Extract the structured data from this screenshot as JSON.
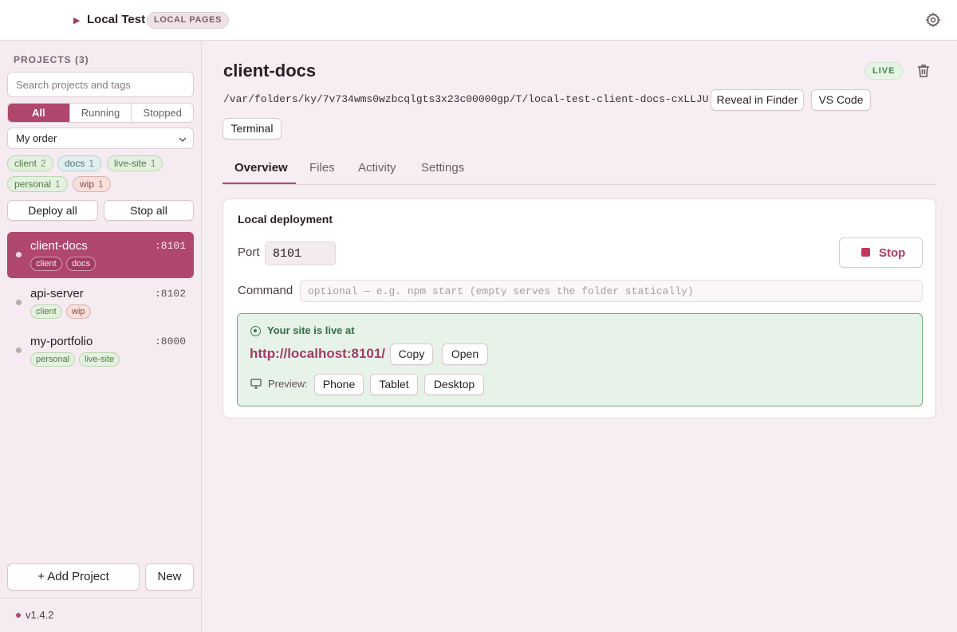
{
  "titlebar": {
    "app_title": "Local Test",
    "badge": "LOCAL PAGES"
  },
  "sidebar": {
    "heading": "PROJECTS (3)",
    "search_placeholder": "Search projects and tags",
    "filters": [
      "All",
      "Running",
      "Stopped"
    ],
    "sort": "My order",
    "tags": [
      {
        "name": "client",
        "count": "2",
        "color": "green"
      },
      {
        "name": "docs",
        "count": "1",
        "color": "teal"
      },
      {
        "name": "live-site",
        "count": "1",
        "color": "green"
      },
      {
        "name": "personal",
        "count": "1",
        "color": "green"
      },
      {
        "name": "wip",
        "count": "1",
        "color": "red"
      }
    ],
    "deploy_all": "Deploy all",
    "stop_all": "Stop all",
    "projects": [
      {
        "name": "client-docs",
        "port": ":8101",
        "tags": [
          "client",
          "docs"
        ],
        "active": true
      },
      {
        "name": "api-server",
        "port": ":8102",
        "tags": [
          "client",
          "wip"
        ],
        "active": false
      },
      {
        "name": "my-portfolio",
        "port": ":8000",
        "tags": [
          "personal",
          "live-site"
        ],
        "active": false
      }
    ],
    "add_project": "+ Add Project",
    "new": "New",
    "version": "v1.4.2"
  },
  "main": {
    "title": "client-docs",
    "status": "LIVE",
    "path": "/var/folders/ky/7v734wms0wzbcqlgts3x23c00000gp/T/local-test-client-docs-cxLLJU",
    "reveal": "Reveal in Finder",
    "vscode": "VS Code",
    "terminal": "Terminal",
    "tabs": [
      "Overview",
      "Files",
      "Activity",
      "Settings"
    ],
    "deployment": {
      "title": "Local deployment",
      "port_label": "Port",
      "port_value": "8101",
      "stop": "Stop",
      "command_label": "Command",
      "command_placeholder": "optional — e.g. npm start (empty serves the folder statically)",
      "live_heading": "Your site is live at",
      "url": "http://localhost:8101/",
      "copy": "Copy",
      "open": "Open",
      "preview_label": "Preview:",
      "preview_options": [
        "Phone",
        "Tablet",
        "Desktop"
      ]
    }
  },
  "colors": {
    "accent": "#b0476f",
    "live_green": "#3b8a4c",
    "sidebar_bg": "#f6ebf1"
  }
}
